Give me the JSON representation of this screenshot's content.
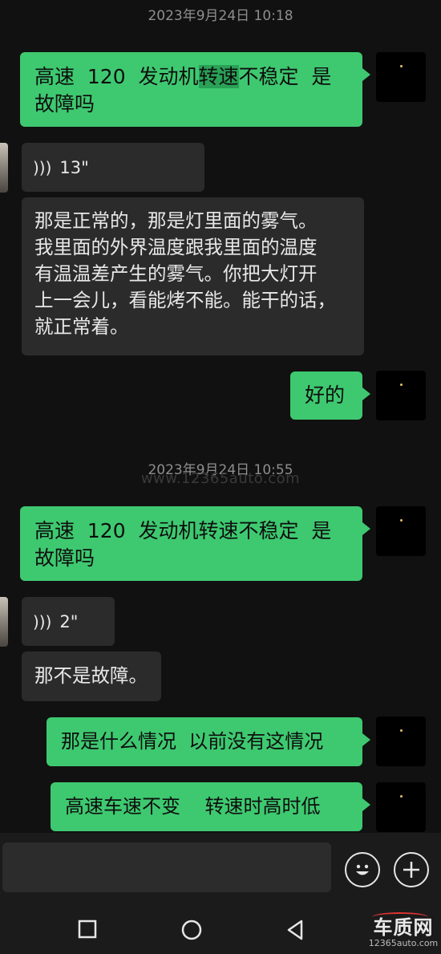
{
  "timestamps": [
    "2023年9月24日 10:18",
    "2023年9月24日 10:55"
  ],
  "watermark": "www.12365auto.com",
  "messages": {
    "m1_a": "高速  120  发动机",
    "m1_hl": "转速",
    "m1_b": "不稳定  是\n故障吗",
    "voice1": "13\"",
    "m2": "那是正常的，那是灯里面的雾气。\n我里面的外界温度跟我里面的温度\n有温温差产生的雾气。你把大灯开\n上一会儿，看能烤不能。能干的话，\n就正常着。",
    "m3": "好的",
    "m4": "高速  120  发动机转速不稳定  是\n故障吗",
    "voice2": "2\"",
    "m5": "那不是故障。",
    "m6": "那是什么情况  以前没有这情况",
    "m7": "高速车速不变    转速时高时低"
  },
  "icons": {
    "voice": "sound-wave-icon",
    "emoji": "emoji-icon",
    "add": "plus-icon",
    "nav_square": "recent-apps-icon",
    "nav_circle": "home-icon",
    "nav_back": "back-icon"
  },
  "logo": {
    "text": "车质网",
    "sub": "12365auto.com"
  },
  "colors": {
    "sent": "#3ec970",
    "received": "#2b2b2b",
    "background": "#111111"
  }
}
